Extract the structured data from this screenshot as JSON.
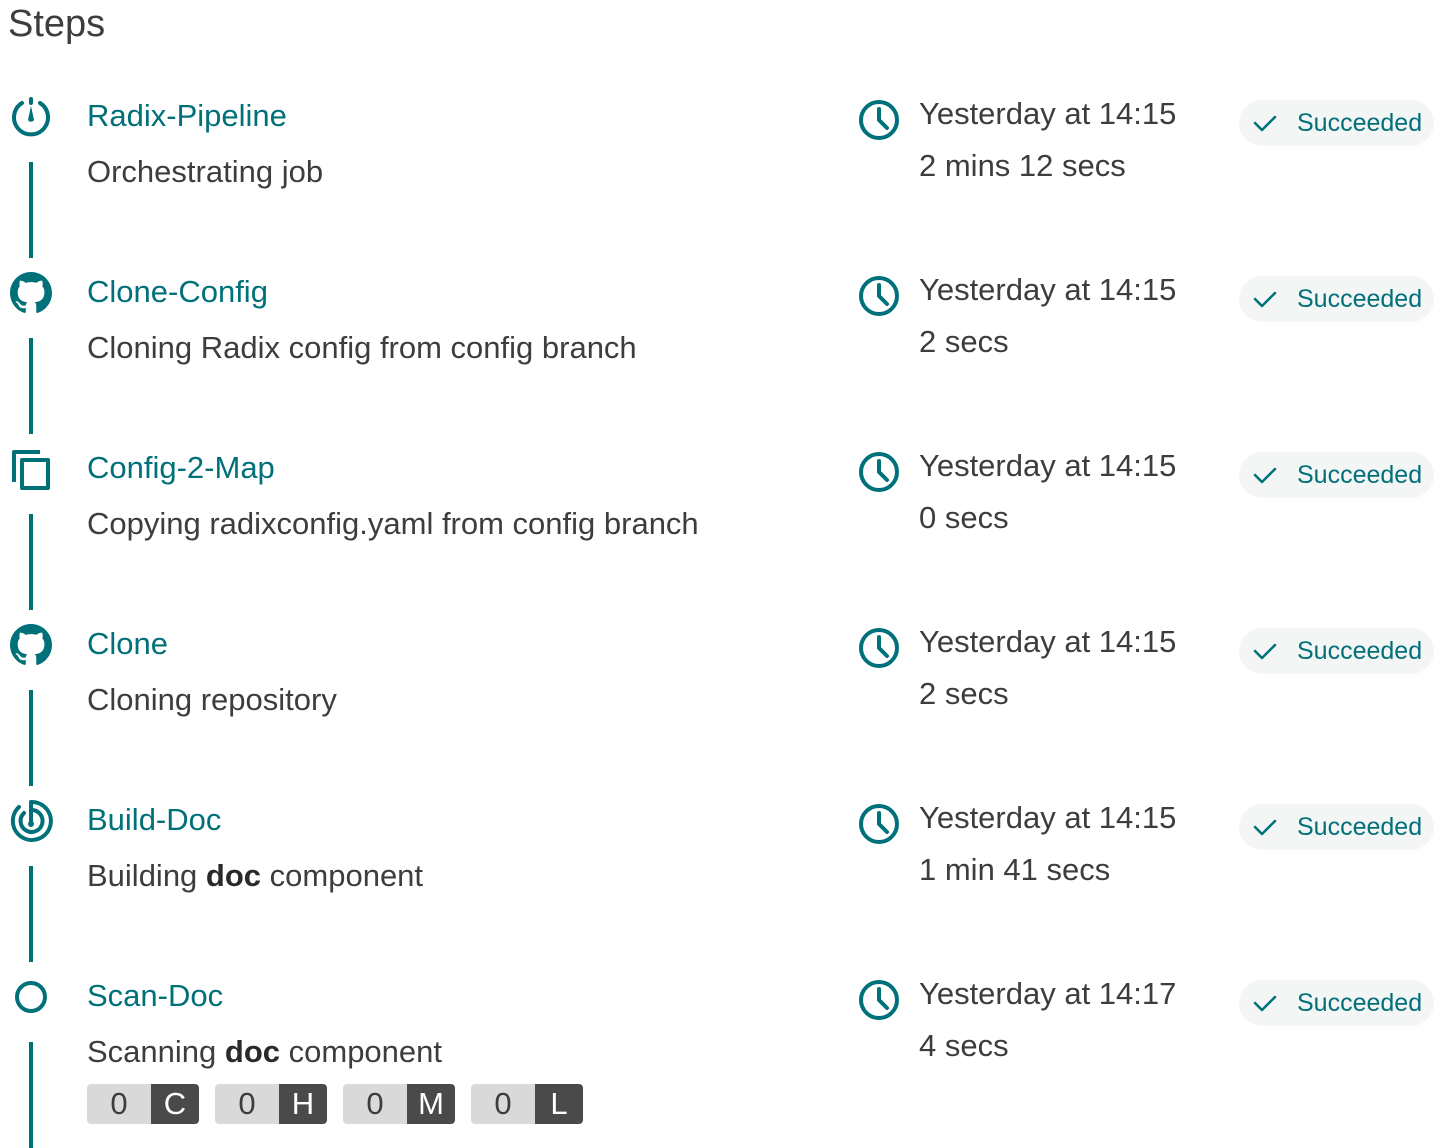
{
  "page": {
    "title": "Steps"
  },
  "colors": {
    "accent": "#007079",
    "text": "#3d3d3d",
    "chip_background": "#f4f5f5",
    "badge_count_background": "#d9d9d9",
    "badge_level_background": "#4a4a4a"
  },
  "steps": [
    {
      "name": "Radix-Pipeline",
      "icon": "pipeline-gauge-icon",
      "description": "Orchestrating job",
      "started": "Yesterday at 14:15",
      "duration": "2 mins 12 secs",
      "status": "Succeeded"
    },
    {
      "name": "Clone-Config",
      "icon": "github-icon",
      "description": "Cloning Radix config from config branch",
      "started": "Yesterday at 14:15",
      "duration": "2 secs",
      "status": "Succeeded"
    },
    {
      "name": "Config-2-Map",
      "icon": "copy-icon",
      "description": "Copying radixconfig.yaml from config branch",
      "started": "Yesterday at 14:15",
      "duration": "0 secs",
      "status": "Succeeded"
    },
    {
      "name": "Clone",
      "icon": "github-icon",
      "description": "Cloning repository",
      "started": "Yesterday at 14:15",
      "duration": "2 secs",
      "status": "Succeeded"
    },
    {
      "name": "Build-Doc",
      "icon": "build-target-icon",
      "description_prefix": "Building ",
      "description_bold": "doc",
      "description_suffix": " component",
      "started": "Yesterday at 14:15",
      "duration": "1 min 41 secs",
      "status": "Succeeded"
    },
    {
      "name": "Scan-Doc",
      "icon": "circle-outline-icon",
      "description_prefix": "Scanning ",
      "description_bold": "doc",
      "description_suffix": " component",
      "started": "Yesterday at 14:17",
      "duration": "4 secs",
      "status": "Succeeded",
      "vulnerabilities": [
        {
          "count": "0",
          "level": "C"
        },
        {
          "count": "0",
          "level": "H"
        },
        {
          "count": "0",
          "level": "M"
        },
        {
          "count": "0",
          "level": "L"
        }
      ]
    }
  ]
}
